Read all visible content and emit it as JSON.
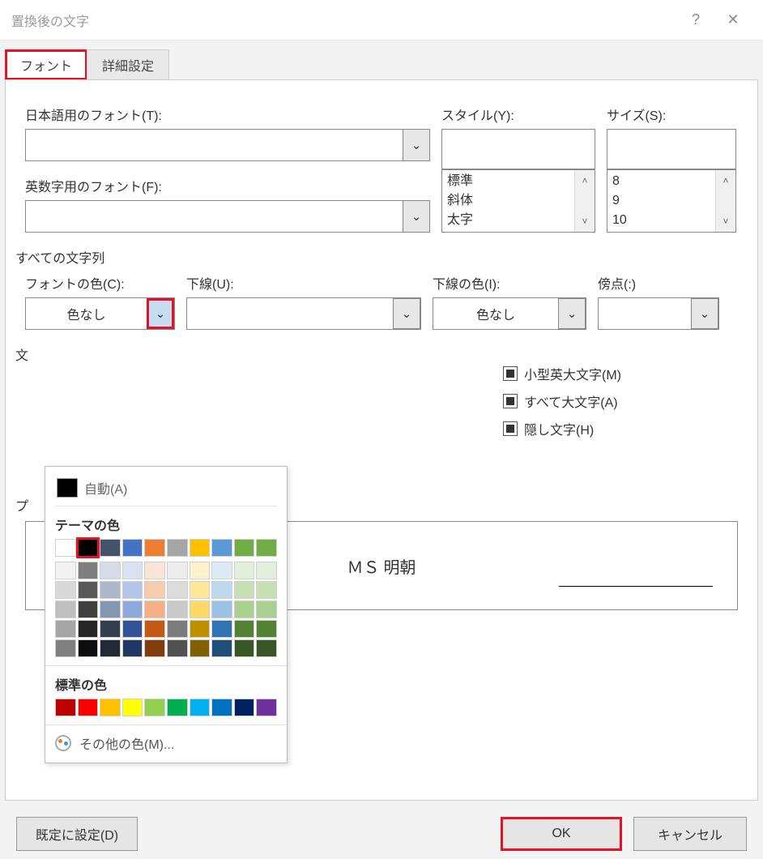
{
  "titlebar": {
    "title": "置換後の文字"
  },
  "tabs": {
    "font": "フォント",
    "advanced": "詳細設定"
  },
  "labels": {
    "jp_font": "日本語用のフォント(T):",
    "latin_font": "英数字用のフォント(F):",
    "style": "スタイル(Y):",
    "size": "サイズ(S):",
    "all_text": "すべての文字列",
    "font_color": "フォントの色(C):",
    "underline": "下線(U):",
    "underline_color": "下線の色(I):",
    "emphasis": "傍点(:)",
    "effects_heading": "文",
    "preview_heading": "プ",
    "small_caps": "小型英大文字(M)",
    "all_caps": "すべて大文字(A)",
    "hidden": "隠し文字(H)",
    "color_none": "色なし"
  },
  "lists": {
    "styles": [
      "標準",
      "斜体",
      "太字"
    ],
    "sizes": [
      "8",
      "9",
      "10"
    ]
  },
  "preview": {
    "sample": "ＭＳ 明朝"
  },
  "buttons": {
    "set_default": "既定に設定(D)",
    "ok": "OK",
    "cancel": "キャンセル"
  },
  "color_popup": {
    "auto": "自動(A)",
    "theme_heading": "テーマの色",
    "standard_heading": "標準の色",
    "more_colors": "その他の色(M)...",
    "theme_row1": [
      "#ffffff",
      "#000000",
      "#44546a",
      "#4472c4",
      "#ed7d31",
      "#a5a5a5",
      "#ffc000",
      "#5b9bd5",
      "#70ad47",
      "#70ad47"
    ],
    "theme_shades": [
      [
        "#f2f2f2",
        "#7f7f7f",
        "#d6dce5",
        "#d9e1f2",
        "#fce4d6",
        "#ededed",
        "#fff2cc",
        "#ddebf7",
        "#e2efda",
        "#e2efda"
      ],
      [
        "#d9d9d9",
        "#595959",
        "#adb9ca",
        "#b4c6e7",
        "#f8cbad",
        "#dbdbdb",
        "#ffe699",
        "#bdd7ee",
        "#c6e0b4",
        "#c6e0b4"
      ],
      [
        "#bfbfbf",
        "#404040",
        "#8497b0",
        "#8ea9db",
        "#f4b084",
        "#c9c9c9",
        "#ffd966",
        "#9bc2e6",
        "#a9d08e",
        "#a9d08e"
      ],
      [
        "#a6a6a6",
        "#262626",
        "#333f4f",
        "#305496",
        "#c65911",
        "#7b7b7b",
        "#bf8f00",
        "#2f75b5",
        "#548235",
        "#548235"
      ],
      [
        "#808080",
        "#0d0d0d",
        "#222b35",
        "#203764",
        "#833c0c",
        "#525252",
        "#806000",
        "#1f4e78",
        "#375623",
        "#375623"
      ]
    ],
    "standard_colors": [
      "#c00000",
      "#ff0000",
      "#ffc000",
      "#ffff00",
      "#92d050",
      "#00b050",
      "#00b0f0",
      "#0070c0",
      "#002060",
      "#7030a0"
    ]
  }
}
